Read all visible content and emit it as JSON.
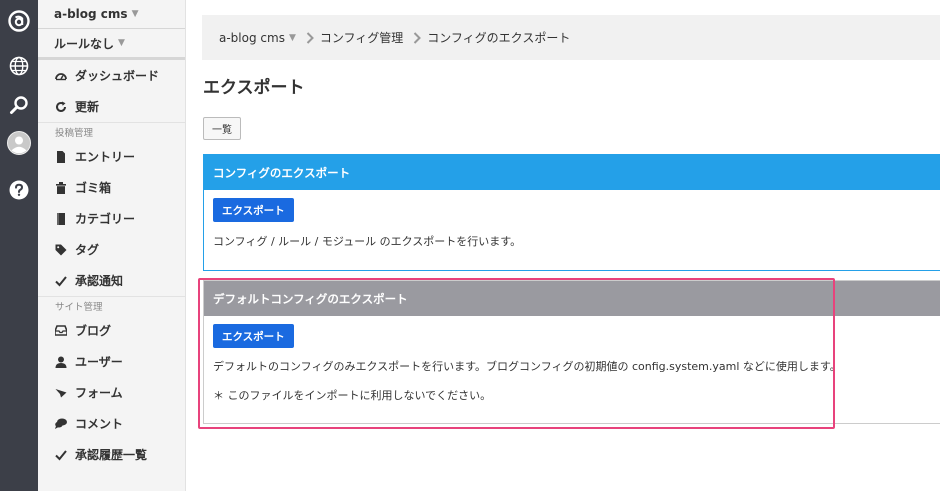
{
  "sidebar": {
    "site_select": "a-blog cms",
    "rule_select": "ルールなし",
    "top_items": [
      {
        "label": "ダッシュボード"
      },
      {
        "label": "更新"
      }
    ],
    "section_post": "投稿管理",
    "post_items": [
      {
        "label": "エントリー"
      },
      {
        "label": "ゴミ箱"
      },
      {
        "label": "カテゴリー"
      },
      {
        "label": "タグ"
      },
      {
        "label": "承認通知"
      }
    ],
    "section_site": "サイト管理",
    "site_items": [
      {
        "label": "ブログ"
      },
      {
        "label": "ユーザー"
      },
      {
        "label": "フォーム"
      },
      {
        "label": "コメント"
      },
      {
        "label": "承認履歴一覧"
      }
    ]
  },
  "breadcrumb": {
    "site": "a-blog cms",
    "level1": "コンフィグ管理",
    "level2": "コンフィグのエクスポート"
  },
  "page": {
    "title": "エクスポート",
    "list_button": "一覧"
  },
  "panels": [
    {
      "title": "コンフィグのエクスポート",
      "button": "エクスポート",
      "description": "コンフィグ / ルール / モジュール のエクスポートを行います。"
    },
    {
      "title": "デフォルトコンフィグのエクスポート",
      "button": "エクスポート",
      "description": "デフォルトのコンフィグのみエクスポートを行います。ブログコンフィグの初期値の config.system.yaml などに使用します。",
      "note": "＊ このファイルをインポートに利用しないでください。"
    }
  ],
  "colors": {
    "rail": "#3c3f48",
    "panel1_header": "#24a0e8",
    "panel2_header": "#9a9aa0",
    "primary_button": "#1a6ae0",
    "highlight": "#e8437c"
  }
}
